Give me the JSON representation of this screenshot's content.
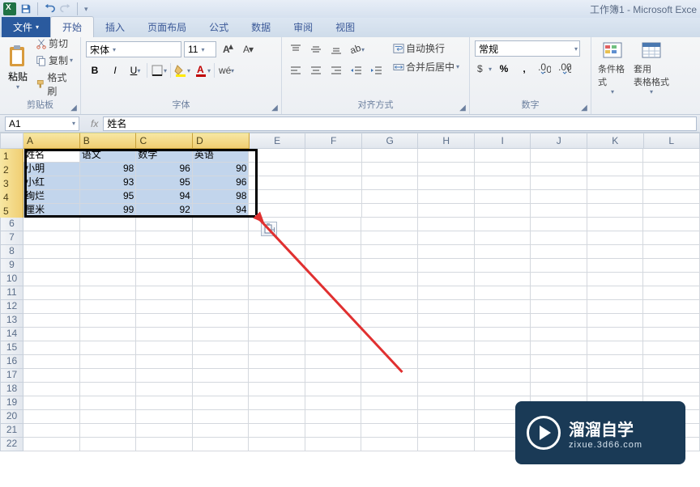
{
  "app": {
    "title": "工作簿1 - Microsoft Exce"
  },
  "tabs": {
    "file": "文件",
    "items": [
      "开始",
      "插入",
      "页面布局",
      "公式",
      "数据",
      "审阅",
      "视图"
    ],
    "active": 0
  },
  "clipboard": {
    "label": "剪贴板",
    "paste": "粘贴",
    "cut": "剪切",
    "copy": "复制",
    "painter": "格式刷"
  },
  "font": {
    "label": "字体",
    "name": "宋体",
    "size": "11"
  },
  "align": {
    "label": "对齐方式",
    "wrap": "自动换行",
    "merge": "合并后居中"
  },
  "number": {
    "label": "数字",
    "format": "常规"
  },
  "styles": {
    "cond": "条件格式",
    "table": "套用\n表格格式"
  },
  "namebox": {
    "ref": "A1",
    "formula": "姓名"
  },
  "cols": [
    "A",
    "B",
    "C",
    "D",
    "E",
    "F",
    "G",
    "H",
    "I",
    "J",
    "K",
    "L"
  ],
  "chart_data": {
    "type": "table",
    "headers": [
      "姓名",
      "语文",
      "数学",
      "英语"
    ],
    "rows": [
      [
        "小明",
        98,
        96,
        90
      ],
      [
        "小红",
        93,
        95,
        96
      ],
      [
        "绚烂",
        95,
        94,
        98
      ],
      [
        "厘米",
        99,
        92,
        94
      ]
    ]
  },
  "watermark": {
    "t1": "溜溜自学",
    "t2": "zixue.3d66.com"
  }
}
